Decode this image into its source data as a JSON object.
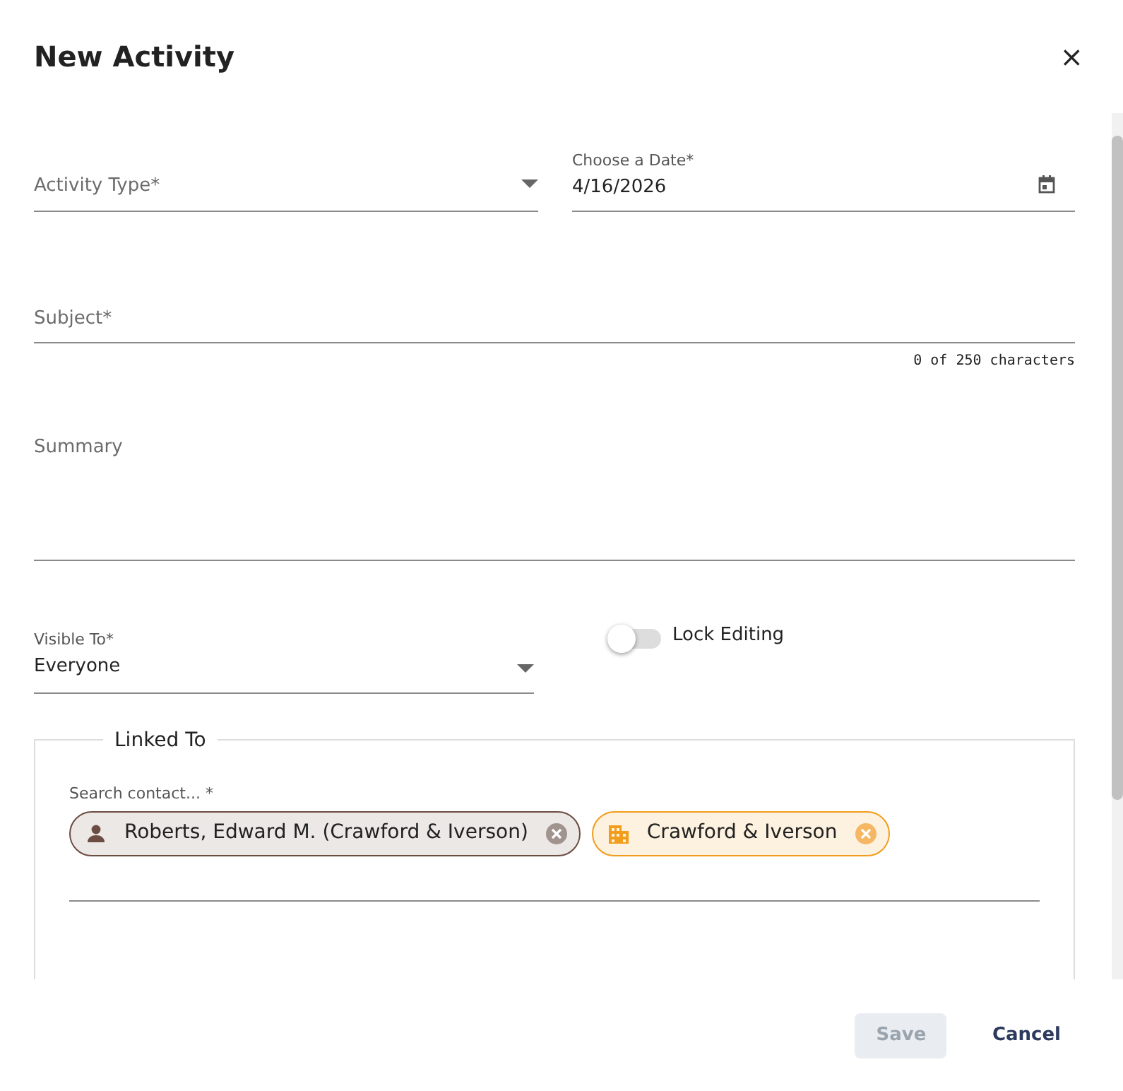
{
  "dialog": {
    "title": "New Activity",
    "close": "×"
  },
  "activity_type": {
    "placeholder": "Activity Type*"
  },
  "date": {
    "label": "Choose a Date*",
    "value": "4/16/2026"
  },
  "subject": {
    "placeholder": "Subject*",
    "counter": "0 of 250 characters"
  },
  "summary": {
    "placeholder": "Summary"
  },
  "visible_to": {
    "label": "Visible To*",
    "value": "Everyone"
  },
  "lock_editing": {
    "label": "Lock Editing",
    "on": false
  },
  "linked_to": {
    "legend": "Linked To",
    "search_label": "Search contact... *",
    "chips": [
      {
        "kind": "contact",
        "text": "Roberts, Edward M. (Crawford & Iverson)"
      },
      {
        "kind": "company",
        "text": "Crawford & Iverson"
      }
    ]
  },
  "buttons": [
    {
      "label": "Save",
      "disabled": true
    },
    {
      "label": "Cancel",
      "disabled": false
    }
  ]
}
